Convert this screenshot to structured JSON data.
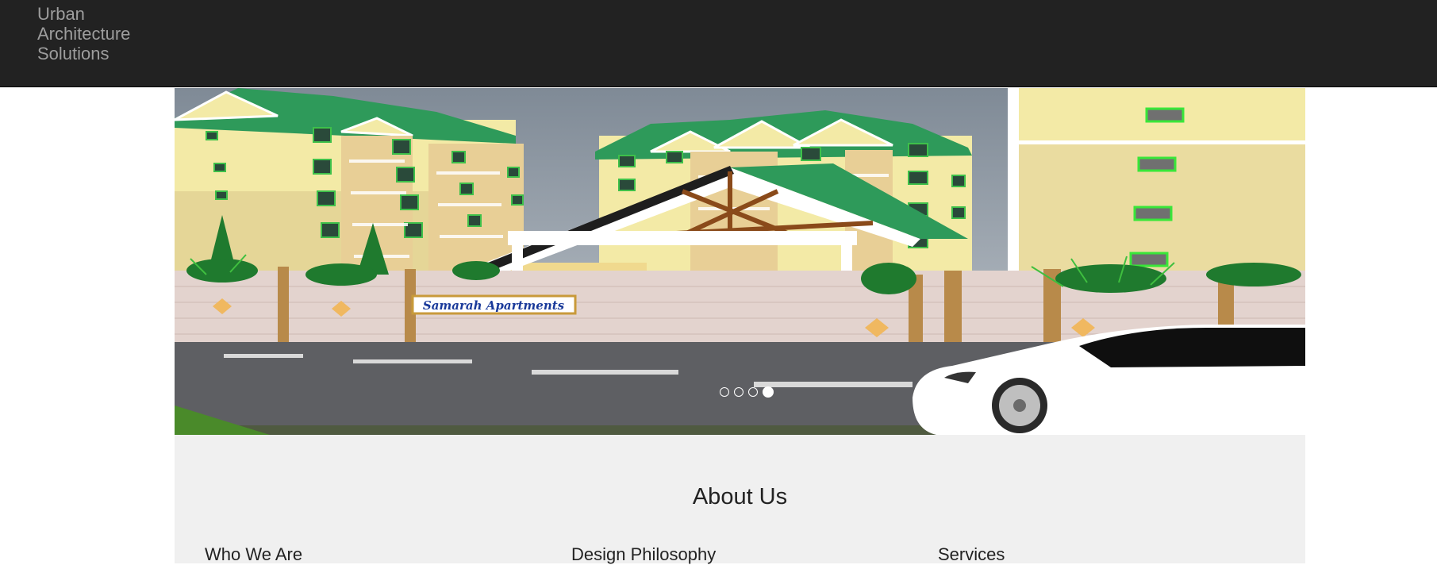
{
  "navbar": {
    "brand_line1": "Urban",
    "brand_line2": "Architecture",
    "brand_line3": "Solutions"
  },
  "carousel": {
    "sign_text": "Samarah Apartments",
    "slide_count": 4,
    "active_index": 3
  },
  "about": {
    "title": "About Us",
    "columns": [
      {
        "heading": "Who We Are"
      },
      {
        "heading": "Design Philosophy"
      },
      {
        "heading": "Services"
      }
    ]
  },
  "colors": {
    "navbar_bg": "#222222",
    "brand_text": "#9d9d9d",
    "section_bg": "#f0f0f0",
    "roof_green": "#2e9a5a",
    "wall_cream": "#f3eaa6"
  }
}
